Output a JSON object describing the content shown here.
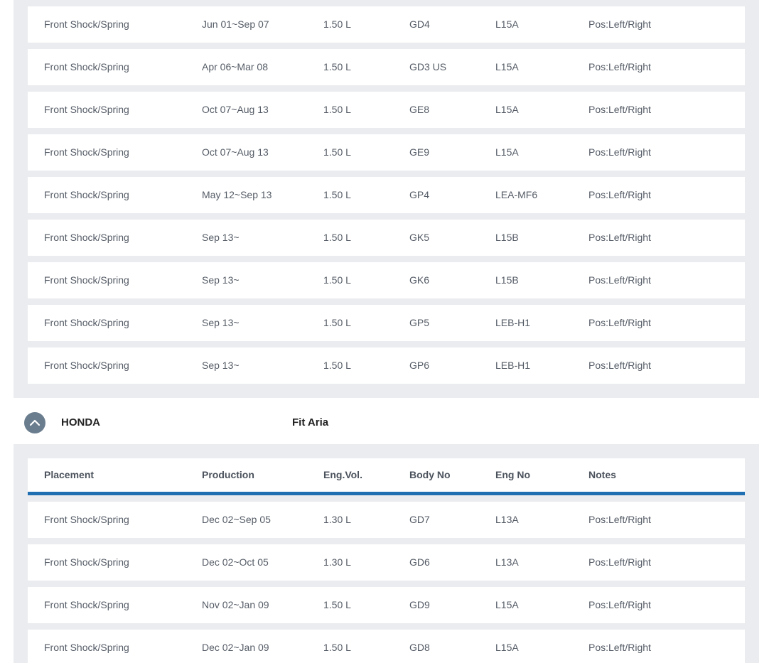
{
  "top_rows": [
    {
      "placement": "Front Shock/Spring",
      "production": "Jun 01~Sep 07",
      "eng_vol": "1.50 L",
      "body_no": "GD4",
      "eng_no": "L15A",
      "notes": "Pos:Left/Right"
    },
    {
      "placement": "Front Shock/Spring",
      "production": "Apr 06~Mar 08",
      "eng_vol": "1.50 L",
      "body_no": "GD3 US",
      "eng_no": "L15A",
      "notes": "Pos:Left/Right"
    },
    {
      "placement": "Front Shock/Spring",
      "production": "Oct 07~Aug 13",
      "eng_vol": "1.50 L",
      "body_no": "GE8",
      "eng_no": "L15A",
      "notes": "Pos:Left/Right"
    },
    {
      "placement": "Front Shock/Spring",
      "production": "Oct 07~Aug 13",
      "eng_vol": "1.50 L",
      "body_no": "GE9",
      "eng_no": "L15A",
      "notes": "Pos:Left/Right"
    },
    {
      "placement": "Front Shock/Spring",
      "production": "May 12~Sep 13",
      "eng_vol": "1.50 L",
      "body_no": "GP4",
      "eng_no": "LEA-MF6",
      "notes": "Pos:Left/Right"
    },
    {
      "placement": "Front Shock/Spring",
      "production": "Sep 13~",
      "eng_vol": "1.50 L",
      "body_no": "GK5",
      "eng_no": "L15B",
      "notes": "Pos:Left/Right"
    },
    {
      "placement": "Front Shock/Spring",
      "production": "Sep 13~",
      "eng_vol": "1.50 L",
      "body_no": "GK6",
      "eng_no": "L15B",
      "notes": "Pos:Left/Right"
    },
    {
      "placement": "Front Shock/Spring",
      "production": "Sep 13~",
      "eng_vol": "1.50 L",
      "body_no": "GP5",
      "eng_no": "LEB-H1",
      "notes": "Pos:Left/Right"
    },
    {
      "placement": "Front Shock/Spring",
      "production": "Sep 13~",
      "eng_vol": "1.50 L",
      "body_no": "GP6",
      "eng_no": "LEB-H1",
      "notes": "Pos:Left/Right"
    }
  ],
  "group": {
    "brand": "HONDA",
    "model": "Fit Aria",
    "toggle_icon": "chevron-up-icon",
    "toggle_color": "#6a7d8e"
  },
  "table": {
    "columns": [
      "Placement",
      "Production",
      "Eng.Vol.",
      "Body No",
      "Eng No",
      "Notes"
    ],
    "header_underline_color": "#1f6fb2",
    "rows": [
      {
        "placement": "Front Shock/Spring",
        "production": "Dec 02~Sep 05",
        "eng_vol": "1.30 L",
        "body_no": "GD7",
        "eng_no": "L13A",
        "notes": "Pos:Left/Right"
      },
      {
        "placement": "Front Shock/Spring",
        "production": "Dec 02~Oct 05",
        "eng_vol": "1.30 L",
        "body_no": "GD6",
        "eng_no": "L13A",
        "notes": "Pos:Left/Right"
      },
      {
        "placement": "Front Shock/Spring",
        "production": "Nov 02~Jan 09",
        "eng_vol": "1.50 L",
        "body_no": "GD9",
        "eng_no": "L15A",
        "notes": "Pos:Left/Right"
      },
      {
        "placement": "Front Shock/Spring",
        "production": "Dec 02~Jan 09",
        "eng_vol": "1.50 L",
        "body_no": "GD8",
        "eng_no": "L15A",
        "notes": "Pos:Left/Right"
      }
    ]
  }
}
